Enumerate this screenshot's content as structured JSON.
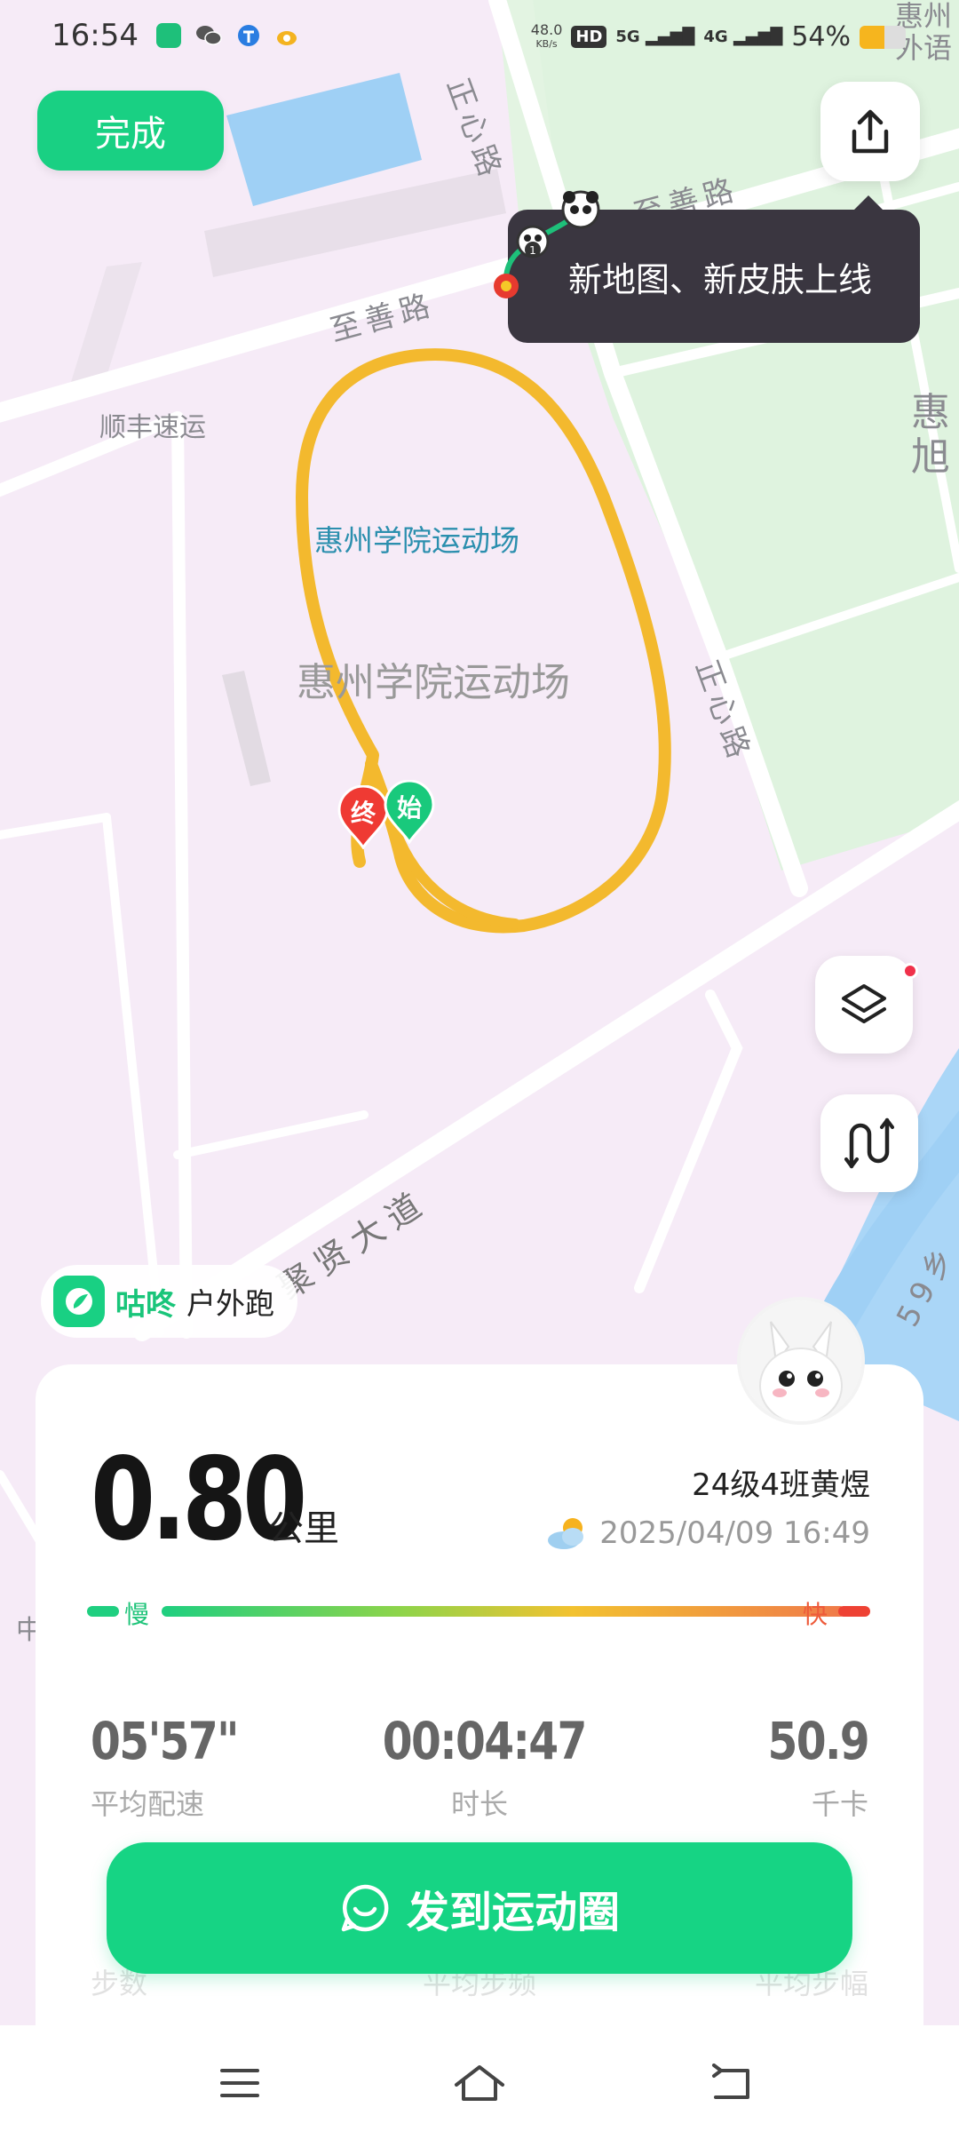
{
  "status_bar": {
    "time": "16:54",
    "net_speed_value": "48.0",
    "net_speed_unit": "KB/s",
    "hd_label": "HD",
    "sim1_label": "5G",
    "sim2_label": "4G",
    "battery_percent": "54%",
    "battery_level": 0.54,
    "app_icons": [
      "chat-app-icon",
      "wechat-icon",
      "telecom-icon",
      "weibo-icon"
    ]
  },
  "header": {
    "done_label": "完成",
    "share_icon": "share-icon"
  },
  "tooltip": {
    "text": "新地图、新皮肤上线",
    "badge_number": "1"
  },
  "map": {
    "labels": {
      "road_zhishan_1": "至善路",
      "road_zhishan_2": "至善路",
      "road_zhengxin_1": "正心路",
      "road_zhengxin_2": "正心路",
      "road_juxian": "聚贤大道",
      "poi_shunfeng": "顺丰速运",
      "poi_stadium_label": "惠州学院运动场",
      "poi_stadium_area": "惠州学院运动场",
      "edge_top_right": "惠州外语",
      "edge_right": "惠旭",
      "edge_right_lower": "59乡",
      "edge_left": "中"
    },
    "markers": {
      "end": "终",
      "start": "始"
    },
    "route_color": "#f3b92e"
  },
  "controls": {
    "layers_icon": "layers-icon",
    "route_icon": "route-icon"
  },
  "brand": {
    "name": "咕咚",
    "activity": "户外跑"
  },
  "summary": {
    "distance": "0.80",
    "distance_unit": "公里",
    "user": "24级4班黄煜",
    "datetime": "2025/04/09 16:49",
    "weather_icon": "partly-cloudy-icon",
    "pace_slow_label": "慢",
    "pace_fast_label": "快",
    "stats": [
      {
        "value": "05'57\"",
        "label": "平均配速"
      },
      {
        "value": "00:04:47",
        "label": "时长"
      },
      {
        "value": "50.9",
        "label": "千卡"
      }
    ],
    "stats2": [
      {
        "label": "步数"
      },
      {
        "label": "平均步频"
      },
      {
        "label": "平均步幅"
      }
    ]
  },
  "post_button": {
    "label": "发到运动圈"
  },
  "nav": {
    "menu_icon": "menu-icon",
    "home_icon": "home-icon",
    "back_icon": "back-icon"
  }
}
